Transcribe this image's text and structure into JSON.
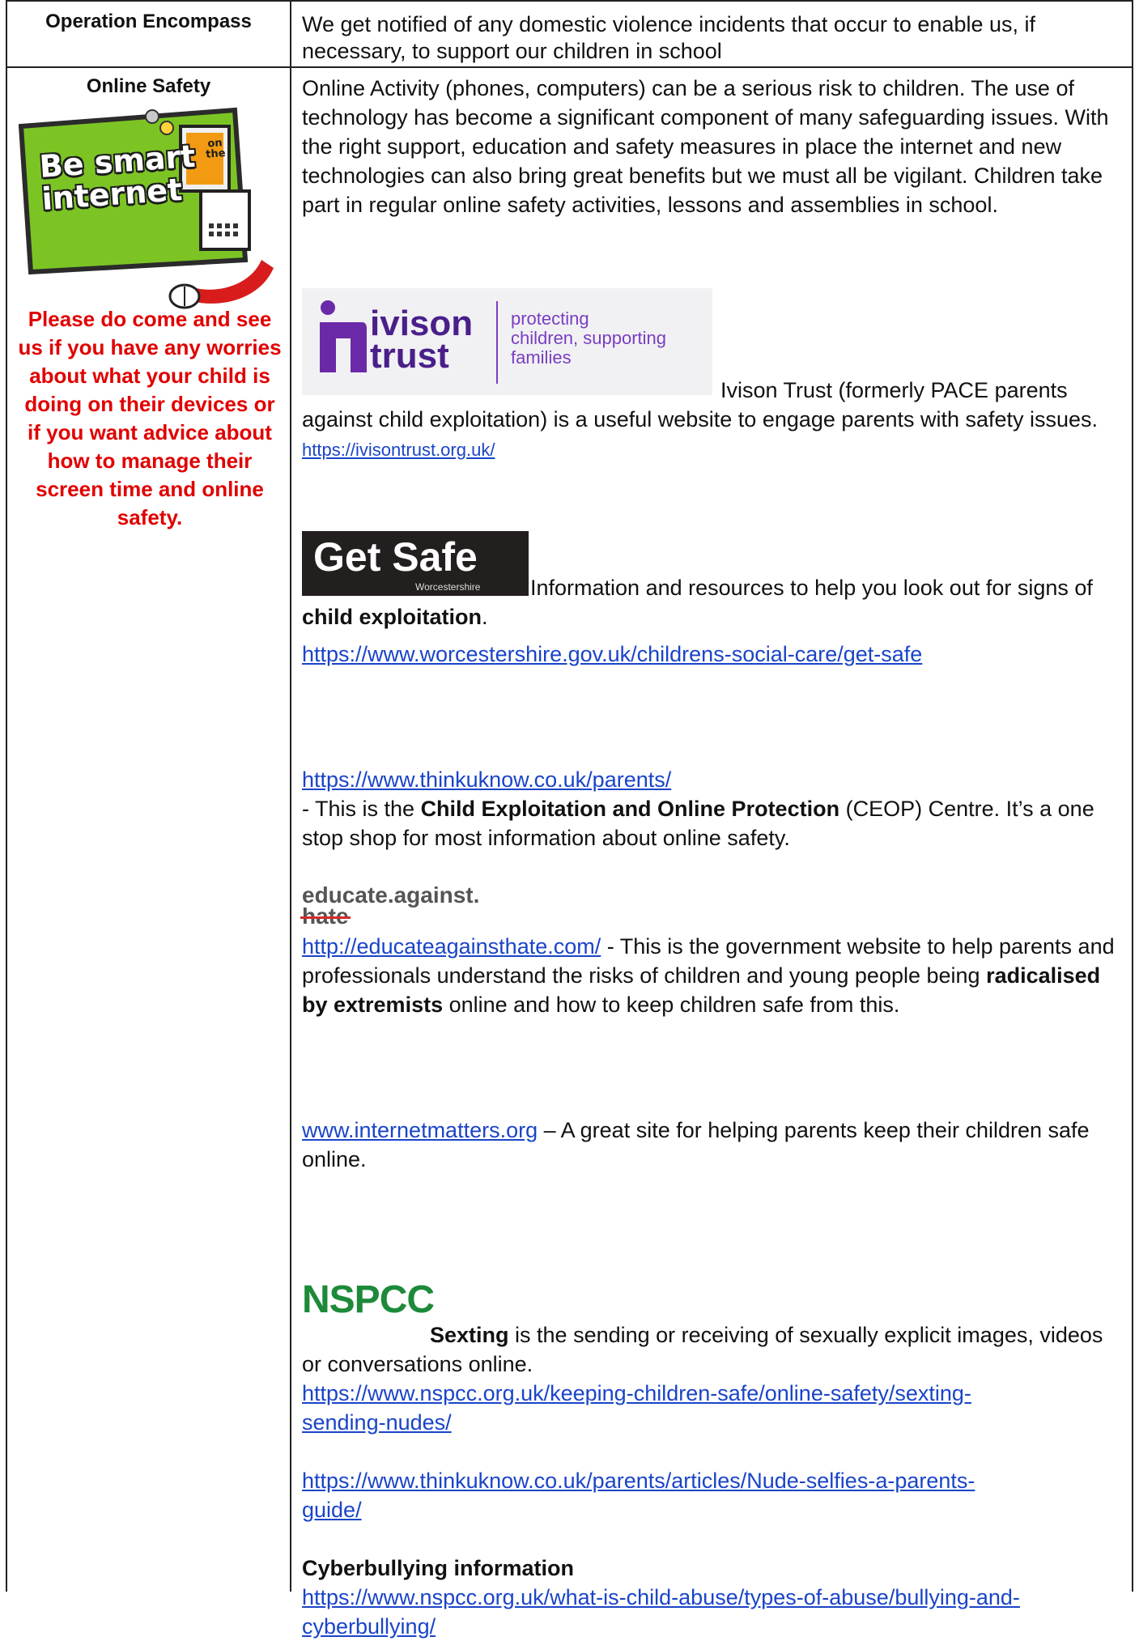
{
  "row1": {
    "label": "Operation Encompass",
    "text": "We get notified of any domestic violence incidents that occur to enable us, if necessary, to support our children in school"
  },
  "row2": {
    "label": "Online Safety",
    "badge_text_line1": "Be smart",
    "badge_text_on": "on",
    "badge_text_the": "the",
    "badge_text_line2": "internet",
    "advice": "Please do come and see us if you have any worries about what your child is doing on their devices or if you want advice about how to manage their screen time and online safety.",
    "intro": "Online Activity (phones, computers) can be a serious risk to children. The use of technology has become a significant component of many safeguarding issues. With the right support, education and safety measures in place the internet and new technologies can also bring great benefits but we must all be vigilant. Children take part in regular online safety activities, lessons and assemblies in school.",
    "ivison": {
      "logo_word1": "ivison",
      "logo_word2": "trust",
      "logo_tagline1": "protecting",
      "logo_tagline2": "children, supporting",
      "logo_tagline3": "families",
      "text": "Ivison Trust (formerly PACE parents against child exploitation) is a useful website to engage parents with safety issues.",
      "link": "https://ivisontrust.org.uk/"
    },
    "getsafe": {
      "logo_title": "Get Safe",
      "logo_sub": "Worcestershire",
      "text_a": "Information and resources to help you look out for signs of ",
      "text_bold": "child exploitation",
      "text_b": ".",
      "link": "https://www.worcestershire.gov.uk/childrens-social-care/get-safe"
    },
    "thinkuknow": {
      "link": "https://www.thinkuknow.co.uk/parents/",
      "text_a": "- This is the ",
      "text_bold": "Child Exploitation and Online Protection",
      "text_b": " (CEOP) Centre. It’s a one stop shop for most information about online safety."
    },
    "eah": {
      "logo_line1": "educate.against.",
      "logo_line2": "hate",
      "link": "http://educateagainsthate.com/",
      "text_a": "  - This is the government website to help parents and professionals understand the risks of children and young people being ",
      "text_bold": "radicalised by extremists",
      "text_b": " online and how to keep children safe from this."
    },
    "internetmatters": {
      "link": "www.internetmatters.org",
      "text": "  – A great site for helping parents keep their children safe online."
    },
    "nspcc": {
      "logo": "NSPCC",
      "text_bold": "Sexting",
      "text": " is the sending or receiving of sexually explicit images, videos or conversations online.",
      "link1a": "https://www.nspcc.org.uk/keeping-children-safe/online-safety/sexting-",
      "link1b": "sending-nudes/",
      "link2a": "https://www.thinkuknow.co.uk/parents/articles/Nude-selfies-a-parents-",
      "link2b": "guide/",
      "cyber_heading": "Cyberbullying information",
      "link3a": "https://www.nspcc.org.uk/what-is-child-abuse/types-of-abuse/bullying-and-",
      "link3b": "cyberbullying/"
    }
  }
}
